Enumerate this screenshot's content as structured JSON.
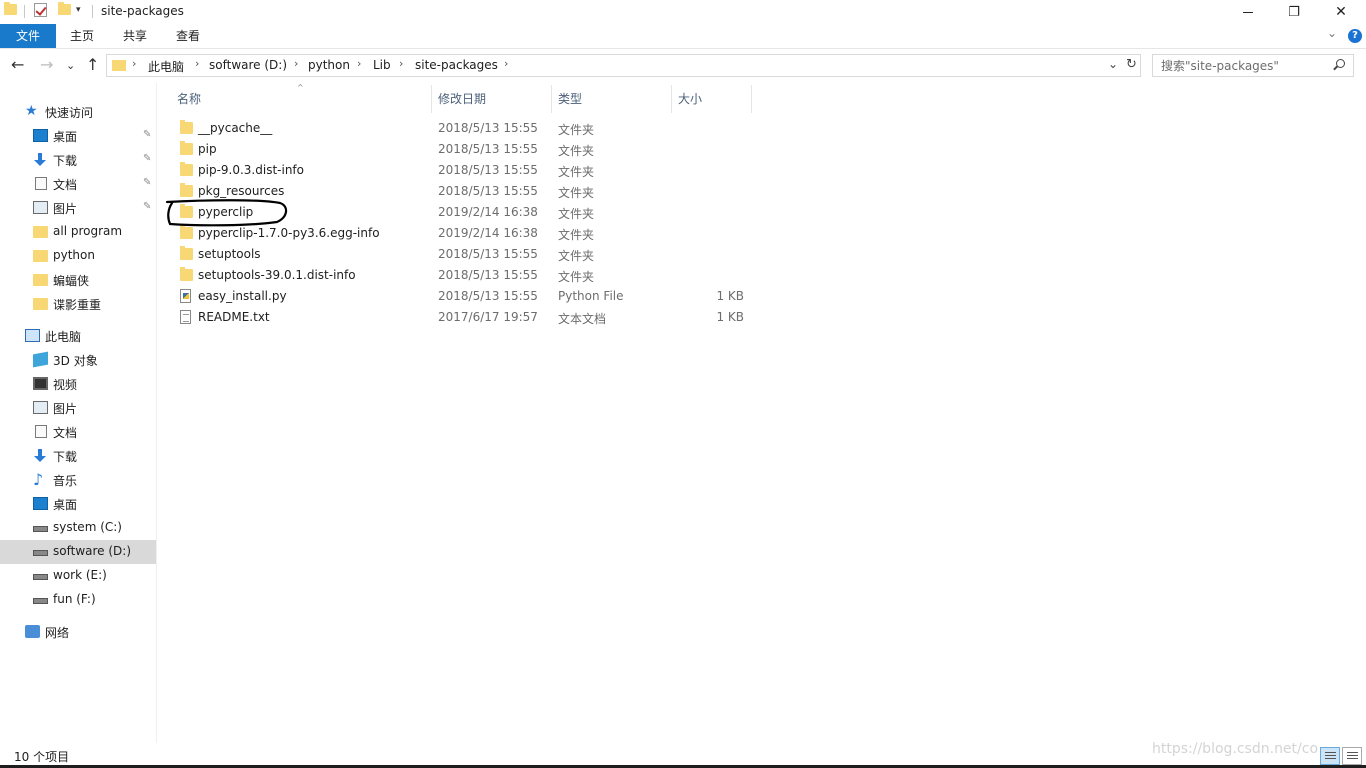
{
  "window": {
    "title": "site-packages",
    "minimize": "—",
    "restore": "❐",
    "close": "✕"
  },
  "ribbon": {
    "tabs": [
      "文件",
      "主页",
      "共享",
      "查看"
    ],
    "expand": "⌄",
    "help": "?"
  },
  "nav": {
    "back": "←",
    "forward": "→",
    "recent": "⌄",
    "up": "↑",
    "breadcrumbs": [
      "此电脑",
      "software (D:)",
      "python",
      "Lib",
      "site-packages"
    ],
    "separator": "›",
    "dropdown": "⌄",
    "refresh": "↻",
    "search_placeholder": "搜索\"site-packages\""
  },
  "sidebar": {
    "quick_access": "快速访问",
    "quick_items": [
      {
        "label": "桌面",
        "icon": "desktop-icon",
        "pinned": true
      },
      {
        "label": "下载",
        "icon": "download-icon",
        "pinned": true
      },
      {
        "label": "文档",
        "icon": "document-icon",
        "pinned": true
      },
      {
        "label": "图片",
        "icon": "pictures-icon",
        "pinned": true
      },
      {
        "label": "all program",
        "icon": "folder-icon",
        "pinned": false
      },
      {
        "label": "python",
        "icon": "folder-icon",
        "pinned": false
      },
      {
        "label": "蝙蝠侠",
        "icon": "folder-icon",
        "pinned": false
      },
      {
        "label": "谍影重重",
        "icon": "folder-icon",
        "pinned": false
      }
    ],
    "this_pc": "此电脑",
    "pc_items": [
      {
        "label": "3D 对象",
        "icon": "3d-objects-icon"
      },
      {
        "label": "视频",
        "icon": "video-icon"
      },
      {
        "label": "图片",
        "icon": "pictures-icon"
      },
      {
        "label": "文档",
        "icon": "document-icon"
      },
      {
        "label": "下载",
        "icon": "download-icon"
      },
      {
        "label": "音乐",
        "icon": "music-icon"
      },
      {
        "label": "桌面",
        "icon": "desktop-icon"
      },
      {
        "label": "system (C:)",
        "icon": "drive-icon"
      },
      {
        "label": "software (D:)",
        "icon": "drive-icon",
        "selected": true
      },
      {
        "label": "work (E:)",
        "icon": "drive-icon"
      },
      {
        "label": "fun (F:)",
        "icon": "drive-icon"
      }
    ],
    "network": "网络",
    "pin_glyph": "📌"
  },
  "columns": {
    "name": "名称",
    "date": "修改日期",
    "type": "类型",
    "size": "大小",
    "sort_glyph": "^"
  },
  "files": [
    {
      "name": "__pycache__",
      "date": "2018/5/13 15:55",
      "type": "文件夹",
      "size": "",
      "icon": "folder-icon"
    },
    {
      "name": "pip",
      "date": "2018/5/13 15:55",
      "type": "文件夹",
      "size": "",
      "icon": "folder-icon"
    },
    {
      "name": "pip-9.0.3.dist-info",
      "date": "2018/5/13 15:55",
      "type": "文件夹",
      "size": "",
      "icon": "folder-icon"
    },
    {
      "name": "pkg_resources",
      "date": "2018/5/13 15:55",
      "type": "文件夹",
      "size": "",
      "icon": "folder-icon"
    },
    {
      "name": "pyperclip",
      "date": "2019/2/14 16:38",
      "type": "文件夹",
      "size": "",
      "icon": "folder-icon"
    },
    {
      "name": "pyperclip-1.7.0-py3.6.egg-info",
      "date": "2019/2/14 16:38",
      "type": "文件夹",
      "size": "",
      "icon": "folder-icon"
    },
    {
      "name": "setuptools",
      "date": "2018/5/13 15:55",
      "type": "文件夹",
      "size": "",
      "icon": "folder-icon"
    },
    {
      "name": "setuptools-39.0.1.dist-info",
      "date": "2018/5/13 15:55",
      "type": "文件夹",
      "size": "",
      "icon": "folder-icon"
    },
    {
      "name": "easy_install.py",
      "date": "2018/5/13 15:55",
      "type": "Python File",
      "size": "1 KB",
      "icon": "python-file-icon"
    },
    {
      "name": "README.txt",
      "date": "2017/6/17 19:57",
      "type": "文本文档",
      "size": "1 KB",
      "icon": "text-file-icon"
    }
  ],
  "status": {
    "item_count": "10 个项目",
    "watermark": "https://blog.csdn.net/co"
  }
}
